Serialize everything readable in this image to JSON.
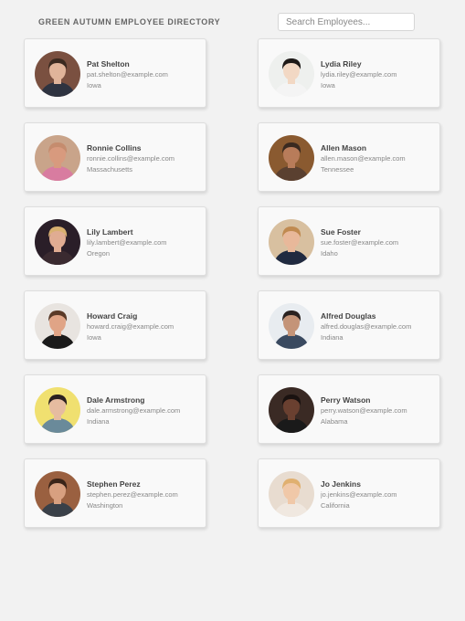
{
  "header": {
    "title": "GREEN AUTUMN EMPLOYEE DIRECTORY",
    "search_placeholder": "Search Employees..."
  },
  "employees": [
    {
      "name": "Pat Shelton",
      "email": "pat.shelton@example.com",
      "location": "Iowa",
      "bg": "#7a5040",
      "skin": "#e0b49a",
      "hair": "#3b2a20",
      "shirt": "#2e3340"
    },
    {
      "name": "Lydia Riley",
      "email": "lydia.riley@example.com",
      "location": "Iowa",
      "bg": "#eef0ee",
      "skin": "#f2d8c4",
      "hair": "#1e1a18",
      "shirt": "#f4f4f4"
    },
    {
      "name": "Ronnie Collins",
      "email": "ronnie.collins@example.com",
      "location": "Massachusetts",
      "bg": "#c9a48a",
      "skin": "#d89a7e",
      "hair": "#c58c6e",
      "shirt": "#d87ca0"
    },
    {
      "name": "Allen Mason",
      "email": "allen.mason@example.com",
      "location": "Tennessee",
      "bg": "#8a5a30",
      "skin": "#b87c5a",
      "hair": "#3a2a20",
      "shirt": "#5a4030"
    },
    {
      "name": "Lily Lambert",
      "email": "lily.lambert@example.com",
      "location": "Oregon",
      "bg": "#2a1e28",
      "skin": "#e0ac92",
      "hair": "#d8b070",
      "shirt": "#3a2a30"
    },
    {
      "name": "Sue Foster",
      "email": "sue.foster@example.com",
      "location": "Idaho",
      "bg": "#d8c0a0",
      "skin": "#e8b89a",
      "hair": "#c08a50",
      "shirt": "#202a40"
    },
    {
      "name": "Howard Craig",
      "email": "howard.craig@example.com",
      "location": "Iowa",
      "bg": "#e8e4e0",
      "skin": "#e0a486",
      "hair": "#5a3a28",
      "shirt": "#1a1a1a"
    },
    {
      "name": "Alfred Douglas",
      "email": "alfred.douglas@example.com",
      "location": "Indiana",
      "bg": "#e8ecf0",
      "skin": "#c49478",
      "hair": "#2a2220",
      "shirt": "#3a4a60"
    },
    {
      "name": "Dale Armstrong",
      "email": "dale.armstrong@example.com",
      "location": "Indiana",
      "bg": "#f0e070",
      "skin": "#e6bca0",
      "hair": "#2a2020",
      "shirt": "#6a8a9a"
    },
    {
      "name": "Perry Watson",
      "email": "perry.watson@example.com",
      "location": "Alabama",
      "bg": "#3a2a24",
      "skin": "#6a4030",
      "hair": "#1a1210",
      "shirt": "#1a1a1a"
    },
    {
      "name": "Stephen Perez",
      "email": "stephen.perez@example.com",
      "location": "Washington",
      "bg": "#9a6040",
      "skin": "#d8a080",
      "hair": "#3a2418",
      "shirt": "#3a4048"
    },
    {
      "name": "Jo Jenkins",
      "email": "jo.jenkins@example.com",
      "location": "California",
      "bg": "#e8dcd0",
      "skin": "#f0c8a8",
      "hair": "#e0b070",
      "shirt": "#f0e8e0"
    }
  ]
}
